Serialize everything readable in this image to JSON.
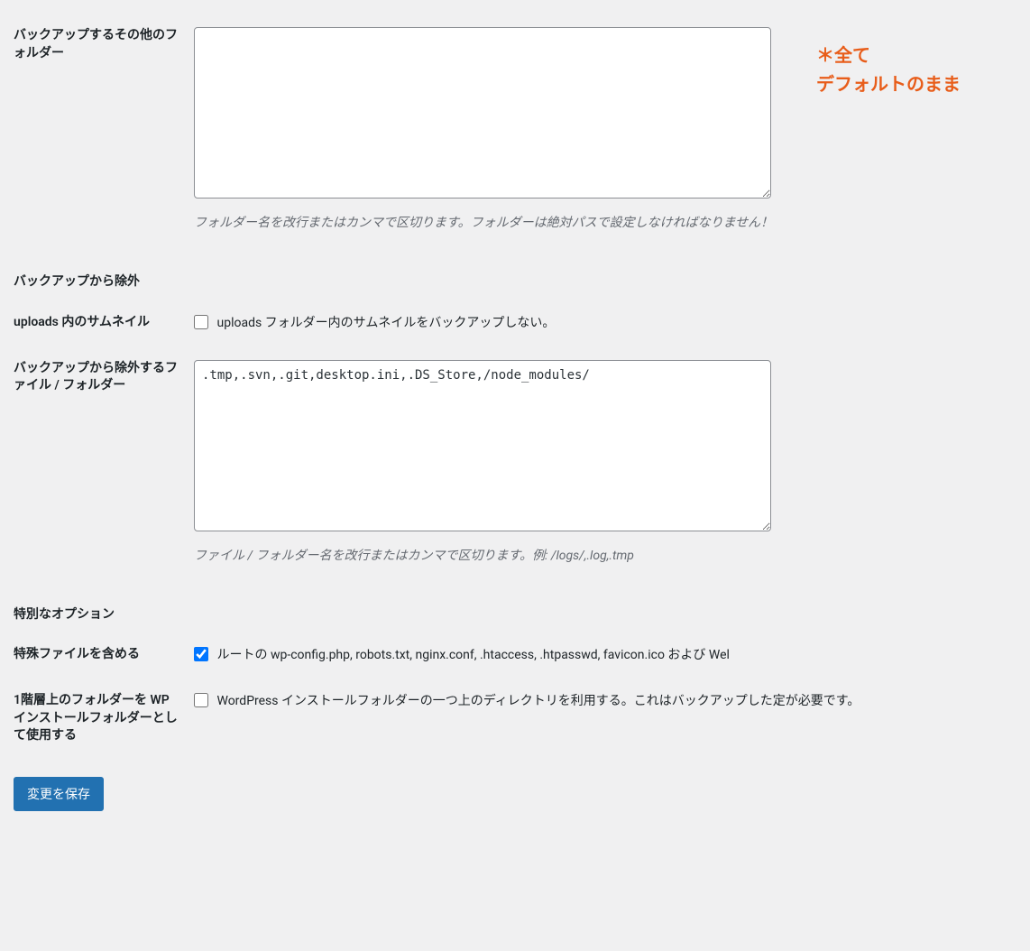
{
  "annotation": {
    "line1": "＊全て",
    "line2": "デフォルトのまま"
  },
  "rows": {
    "extra_folders": {
      "label": "バックアップするその他のフォルダー",
      "value": "",
      "description": "フォルダー名を改行またはカンマで区切ります。フォルダーは絶対パスで設定しなければなりません！"
    },
    "exclude_section": {
      "label": "バックアップから除外"
    },
    "thumbnails": {
      "label": "uploads 内のサムネイル",
      "checkbox_label": "uploads フォルダー内のサムネイルをバックアップしない。",
      "checked": false
    },
    "exclude_files": {
      "label": "バックアップから除外するファイル / フォルダー",
      "value": ".tmp,.svn,.git,desktop.ini,.DS_Store,/node_modules/",
      "description": "ファイル / フォルダー名を改行またはカンマで区切ります。例: /logs/,.log,.tmp"
    },
    "special_section": {
      "label": "特別なオプション"
    },
    "special_files": {
      "label": "特殊ファイルを含める",
      "checkbox_label": "ルートの wp-config.php, robots.txt, nginx.conf, .htaccess, .htpasswd, favicon.ico および Wel",
      "checked": true
    },
    "one_level_up": {
      "label": "1階層上のフォルダーを WP インストールフォルダーとして使用する",
      "checkbox_label": "WordPress インストールフォルダーの一つ上のディレクトリを利用する。これはバックアップした定が必要です。",
      "checked": false
    }
  },
  "submit": {
    "label": "変更を保存"
  }
}
